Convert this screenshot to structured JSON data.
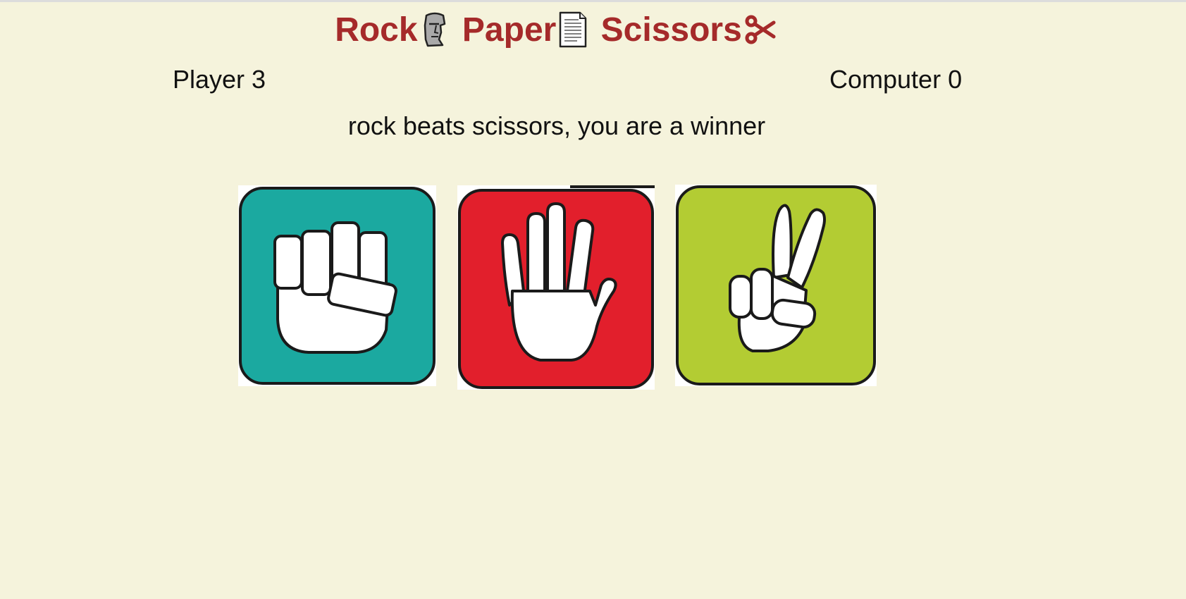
{
  "header": {
    "title_rock": "Rock",
    "title_paper": "Paper",
    "title_scissors": "Scissors"
  },
  "scoreboard": {
    "player": "Player 3",
    "computer": "Computer 0"
  },
  "result": {
    "message": "rock beats scissors, you are a winner"
  },
  "choices": [
    {
      "label": "rock",
      "icon": "fist-icon",
      "color": "#1ba9a0"
    },
    {
      "label": "paper",
      "icon": "open-hand-icon",
      "color": "#e21f2c"
    },
    {
      "label": "scissors",
      "icon": "peace-hand-icon",
      "color": "#b3cc33"
    }
  ],
  "colors": {
    "background": "#f5f3dc",
    "title": "#a52a2a"
  }
}
